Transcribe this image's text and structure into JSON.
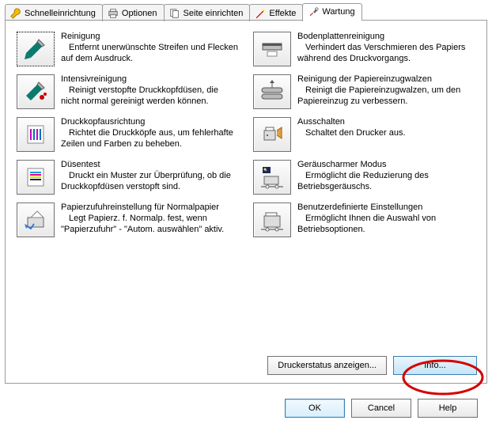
{
  "tabs": {
    "quick": "Schnelleinrichtung",
    "options": "Optionen",
    "page_setup": "Seite einrichten",
    "effects": "Effekte",
    "maintenance": "Wartung"
  },
  "items": {
    "cleaning": {
      "title": "Reinigung",
      "desc": "Entfernt unerwünschte Streifen und Flecken auf dem Ausdruck."
    },
    "bottom_plate": {
      "title": "Bodenplattenreinigung",
      "desc": "Verhindert das Verschmieren des Papiers während des Druckvorgangs."
    },
    "deep_cleaning": {
      "title": "Intensivreinigung",
      "desc": "Reinigt verstopfte Druckkopfdüsen, die nicht normal gereinigt werden können."
    },
    "roller_cleaning": {
      "title": "Reinigung der Papiereinzugwalzen",
      "desc": "Reinigt die Papiereinzugwalzen, um den Papiereinzug zu verbessern."
    },
    "head_alignment": {
      "title": "Druckkopfausrichtung",
      "desc": "Richtet die Druckköpfe aus, um fehlerhafte Zeilen und Farben zu beheben."
    },
    "power_off": {
      "title": "Ausschalten",
      "desc": "Schaltet den Drucker aus."
    },
    "nozzle_check": {
      "title": "Düsentest",
      "desc": "Druckt ein Muster zur Überprüfung, ob die Druckkopfdüsen verstopft sind."
    },
    "quiet_mode": {
      "title": "Geräuscharmer Modus",
      "desc": "Ermöglicht die Reduzierung des Betriebsgeräuschs."
    },
    "paper_source": {
      "title": "Papierzufuhreinstellung für Normalpapier",
      "desc": "Legt Papierz. f. Normalp. fest, wenn \"Papierzufuhr\" - \"Autom. auswählen\" aktiv."
    },
    "custom_settings": {
      "title": "Benutzerdefinierte Einstellungen",
      "desc": "Ermöglicht Ihnen die Auswahl von Betriebsoptionen."
    }
  },
  "buttons": {
    "printer_status": "Druckerstatus anzeigen...",
    "about": "Info...",
    "ok": "OK",
    "cancel": "Cancel",
    "help": "Help"
  }
}
